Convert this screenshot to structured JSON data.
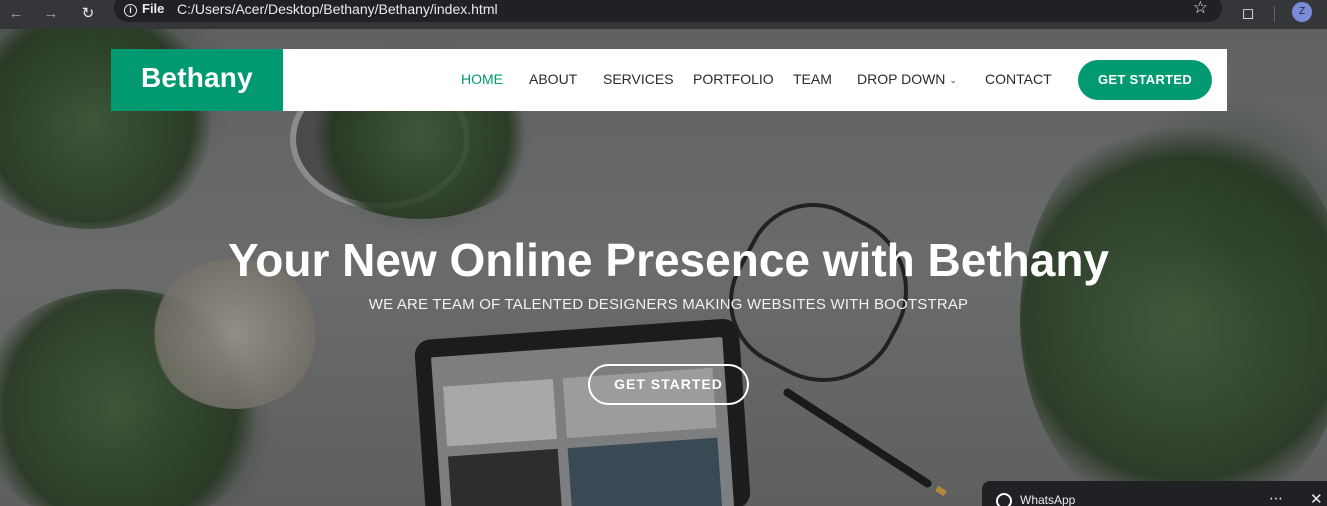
{
  "browser": {
    "back_icon": "arrow-left-icon",
    "forward_icon": "arrow-right-icon",
    "reload_icon": "reload-icon",
    "scheme_label": "File",
    "url": "C:/Users/Acer/Desktop/Bethany/Bethany/index.html",
    "profile_initial": "Z"
  },
  "header": {
    "logo": "Bethany",
    "nav": [
      {
        "label": "HOME",
        "active": true
      },
      {
        "label": "ABOUT"
      },
      {
        "label": "SERVICES"
      },
      {
        "label": "PORTFOLIO"
      },
      {
        "label": "TEAM"
      },
      {
        "label": "DROP DOWN"
      },
      {
        "label": "CONTACT"
      }
    ],
    "cta_label": "GET STARTED"
  },
  "hero": {
    "title": "Your New Online Presence with Bethany",
    "subtitle": "WE ARE TEAM OF TALENTED DESIGNERS MAKING WEBSITES WITH BOOTSTRAP",
    "cta_label": "GET STARTED"
  },
  "whatsapp_widget": {
    "title": "WhatsApp"
  },
  "colors": {
    "brand": "#009970",
    "header_bg": "#ffffff",
    "chrome_bg": "#35363a"
  }
}
